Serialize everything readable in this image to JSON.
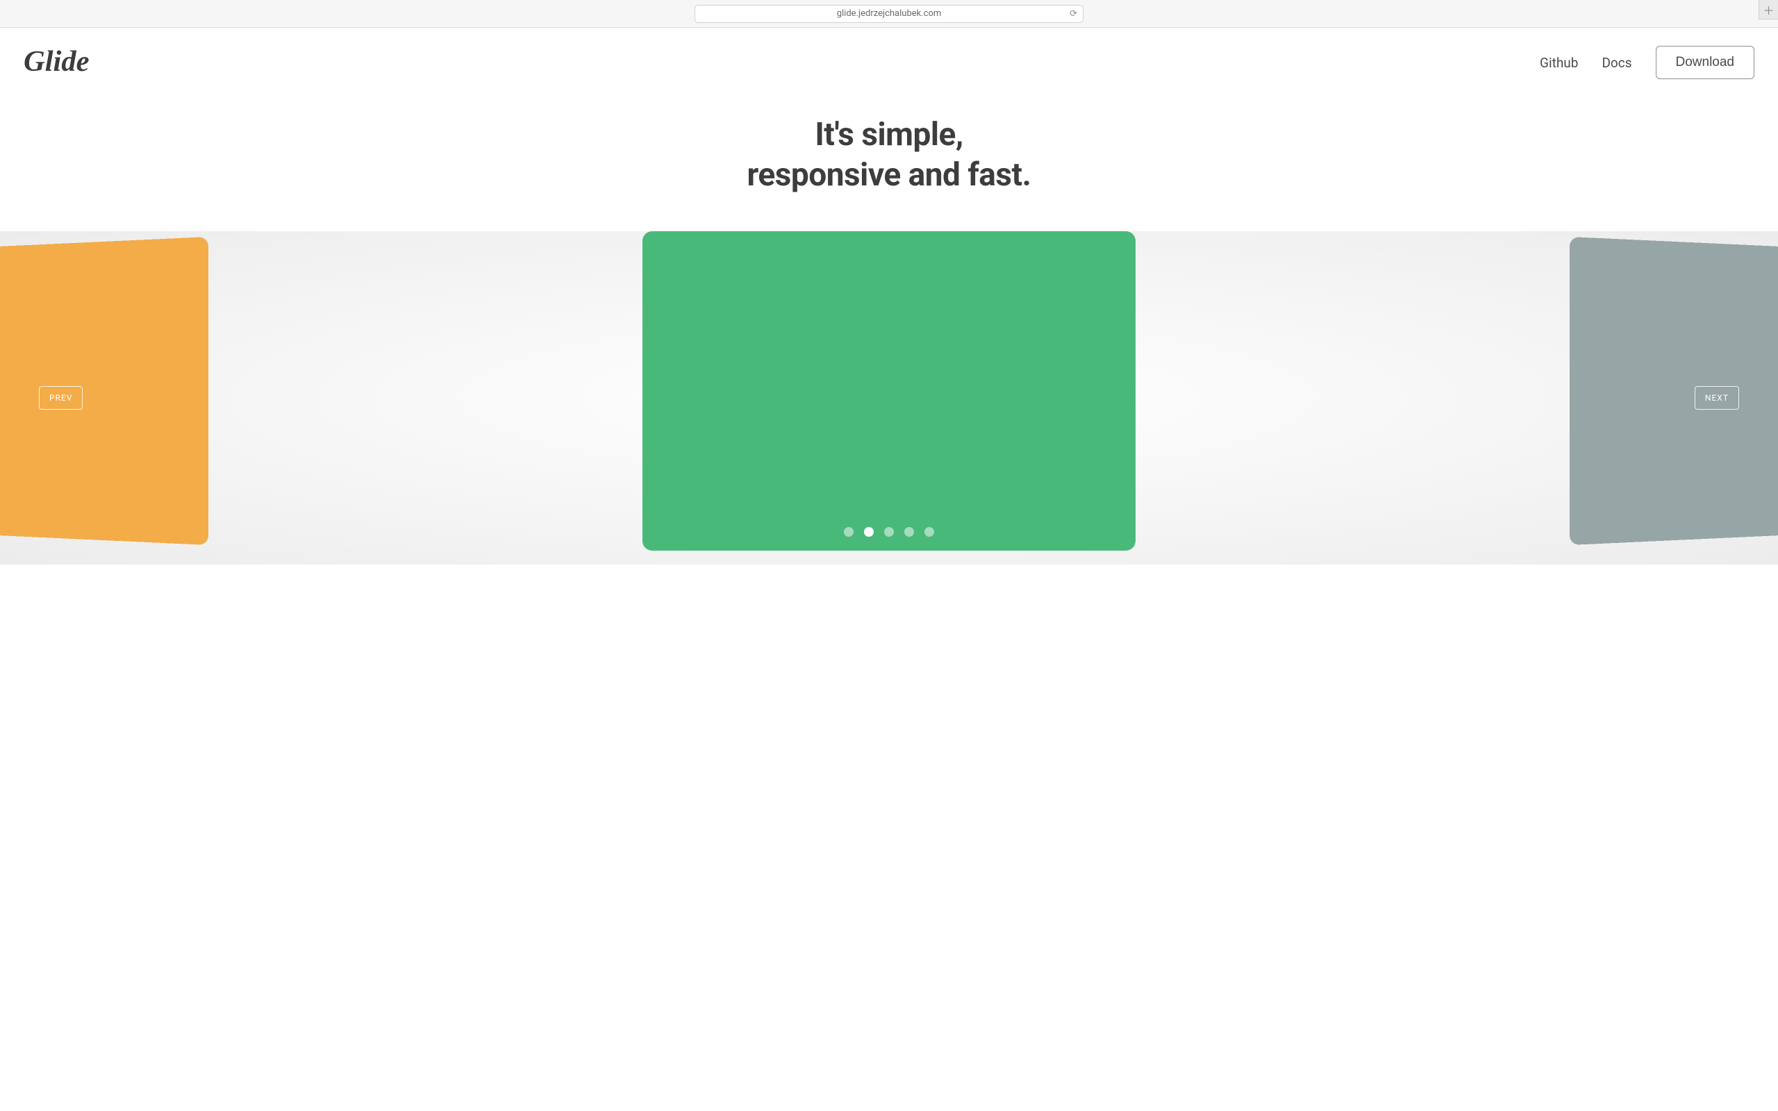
{
  "browser": {
    "url": "glide.jedrzejchalubek.com"
  },
  "nav": {
    "logo_text": "Glide",
    "links": [
      "Github",
      "Docs"
    ],
    "download_label": "Download"
  },
  "hero": {
    "line1": "It's simple,",
    "line2": "responsive and fast."
  },
  "carousel": {
    "prev_label": "PREV",
    "next_label": "NEXT",
    "slides": [
      {
        "color": "#f3ac48"
      },
      {
        "color": "#49b97a"
      },
      {
        "color": "#96a5a6"
      }
    ],
    "active_index": 1,
    "dot_count": 5
  }
}
